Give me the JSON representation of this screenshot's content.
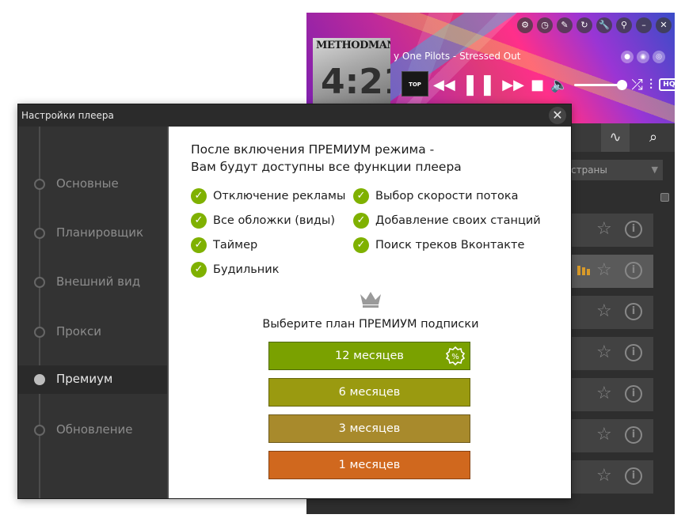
{
  "player": {
    "track_title": "y One Pilots - Stressed Out",
    "album_title": "METHODMAN",
    "album_number": "4:21",
    "badge_top200": "TOP 200",
    "hq_label": "HQ",
    "filter_select": "страны"
  },
  "dialog": {
    "title": "Настройки плеера",
    "close": "✕",
    "nav": [
      {
        "label": "Основные"
      },
      {
        "label": "Планировщик"
      },
      {
        "label": "Внешний вид"
      },
      {
        "label": "Прокси"
      },
      {
        "label": "Премиум",
        "active": true
      },
      {
        "label": "Обновление"
      }
    ],
    "header_line1": "После включения ПРЕМИУМ режима -",
    "header_line2": "Вам будут доступны все функции плеера",
    "features_left": [
      "Отключение рекламы",
      "Все обложки (виды)",
      "Таймер",
      "Будильник"
    ],
    "features_right": [
      "Выбор скорости потока",
      "Добавление своих станций",
      "Поиск треков Вконтакте"
    ],
    "plan_prompt": "Выберите план ПРЕМИУМ подписки",
    "plans": [
      {
        "label": "12 месяцев",
        "color": "#7aa100",
        "badge": "discount-badge-icon"
      },
      {
        "label": "6 месяцев",
        "color": "#9a9a10"
      },
      {
        "label": "3 месяцев",
        "color": "#a88a2c"
      },
      {
        "label": "1 месяцев",
        "color": "#d0681e"
      }
    ]
  },
  "colors": {
    "check_green": "#7fb100",
    "sidebar_bg": "#333333",
    "titlebar_bg": "#2b2b2b"
  }
}
